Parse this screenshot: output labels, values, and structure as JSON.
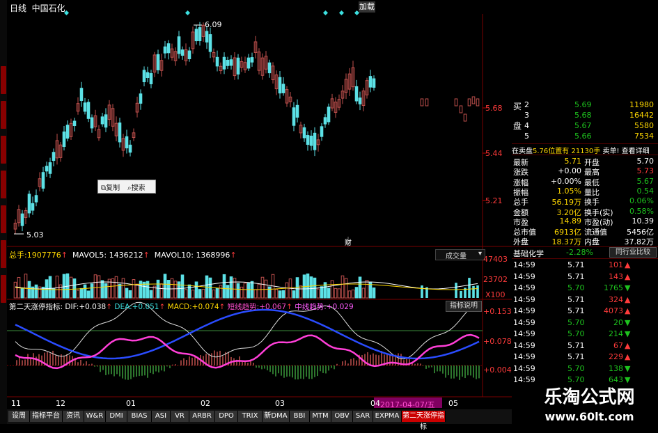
{
  "header": {
    "period": "日线",
    "stock_name": "中国石化",
    "load_button": "加载"
  },
  "price_chart": {
    "high_label": "6.09",
    "low_label": "5.03",
    "axis_ticks": [
      "5.68",
      "5.44",
      "5.21"
    ],
    "marker_label": "财",
    "popup": {
      "copy": "复制",
      "search": "搜索"
    }
  },
  "volume_panel": {
    "total_label": "总手:",
    "total_value": "1907776",
    "mavol5_label": "MAVOL5:",
    "mavol5_value": "1436212",
    "mavol10_label": "MAVOL10:",
    "mavol10_value": "1368996",
    "axis_ticks": [
      "47403",
      "23702",
      "X100"
    ],
    "dropdown_label": "成交量"
  },
  "indicator_panel": {
    "name": "第二天涨停指标:",
    "dif_label": "DIF:",
    "dif_value": "+0.038",
    "dea_label": "DEA:",
    "dea_value": "+0.051",
    "macd_label": "MACD:",
    "macd_value": "+0.074",
    "short_label": "短线趋势:",
    "short_value": "+0.067",
    "mid_label": "中线趋势:",
    "mid_value": "+0.029",
    "help_button": "指标说明",
    "axis_ticks": [
      "+0.153",
      "+0.078",
      "+0.004"
    ]
  },
  "x_axis": {
    "labels": [
      "11",
      "12",
      "01",
      "02",
      "03",
      "04",
      "05"
    ],
    "cursor_date": "2017-04-07/五"
  },
  "order_book": {
    "buy_label_1": "买",
    "buy_label_2": "盘",
    "rows": [
      {
        "level": "2",
        "price": "5.69",
        "vol": "11980"
      },
      {
        "level": "3",
        "price": "5.68",
        "vol": "16442"
      },
      {
        "level": "4",
        "price": "5.67",
        "vol": "5580"
      },
      {
        "level": "5",
        "price": "5.66",
        "vol": "7534"
      }
    ]
  },
  "info_bar": {
    "text1": "在卖盘",
    "text2": "5.76位置有",
    "text3": "21130手",
    "text4": "卖单!",
    "text5": "查看详细"
  },
  "quote": {
    "rows": [
      {
        "l1": "最新",
        "v1": "5.71",
        "l2": "开盘",
        "v2": "5.70"
      },
      {
        "l1": "涨跌",
        "v1": "+0.00",
        "l2": "最高",
        "v2": "5.73"
      },
      {
        "l1": "涨幅",
        "v1": "+0.00%",
        "l2": "最低",
        "v2": "5.67"
      },
      {
        "l1": "振幅",
        "v1": "1.05%",
        "l2": "量比",
        "v2": "0.54"
      },
      {
        "l1": "总手",
        "v1": "56.19万",
        "l2": "换手",
        "v2": "0.06%"
      },
      {
        "l1": "金额",
        "v1": "3.20亿",
        "l2": "换手(实)",
        "v2": "0.58%"
      },
      {
        "l1": "市盈",
        "v1": "14.89",
        "l2": "市盈(动)",
        "v2": "10.39"
      },
      {
        "l1": "总市值",
        "v1": "6913亿",
        "l2": "流通值",
        "v2": "5456亿"
      },
      {
        "l1": "外盘",
        "v1": "18.37万",
        "l2": "内盘",
        "v2": "37.82万"
      }
    ]
  },
  "sector": {
    "name": "基础化学",
    "change": "-2.28%",
    "compare_button": "同行业比较"
  },
  "ticks": [
    {
      "time": "14:59",
      "price": "5.71",
      "vol": "101",
      "dir": "up"
    },
    {
      "time": "14:59",
      "price": "5.71",
      "vol": "143",
      "dir": "up"
    },
    {
      "time": "14:59",
      "price": "5.70",
      "vol": "1765",
      "dir": "down"
    },
    {
      "time": "14:59",
      "price": "5.71",
      "vol": "324",
      "dir": "up"
    },
    {
      "time": "14:59",
      "price": "5.71",
      "vol": "4073",
      "dir": "up"
    },
    {
      "time": "14:59",
      "price": "5.70",
      "vol": "20",
      "dir": "down"
    },
    {
      "time": "14:59",
      "price": "5.70",
      "vol": "214",
      "dir": "down"
    },
    {
      "time": "14:59",
      "price": "5.71",
      "vol": "67",
      "dir": "up"
    },
    {
      "time": "14:59",
      "price": "5.71",
      "vol": "229",
      "dir": "up"
    },
    {
      "time": "14:59",
      "price": "5.70",
      "vol": "138",
      "dir": "down"
    },
    {
      "time": "14:59",
      "price": "5.70",
      "vol": "643",
      "dir": "down"
    }
  ],
  "bottom_tabs": [
    "设周",
    "指标平台",
    "资讯",
    "W&R",
    "DMI",
    "BIAS",
    "ASI",
    "VR",
    "ARBR",
    "DPO",
    "TRIX",
    "新DMA",
    "BBI",
    "MTM",
    "OBV",
    "SAR",
    "EXPMA",
    "第二天涨停指标"
  ],
  "watermark": {
    "line1": "乐淘公式网",
    "line2": "www.60lt.com"
  },
  "colors": {
    "up": "#ff3b3b",
    "down": "#1ec31e",
    "candle_up": "#c0504d",
    "candle_down": "#5ce1e6",
    "accent": "#ffd800"
  }
}
